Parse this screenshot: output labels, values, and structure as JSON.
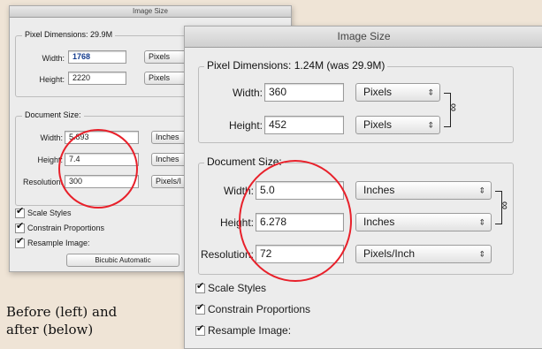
{
  "before": {
    "title": "Image Size",
    "pixel_dimensions": {
      "label": "Pixel Dimensions:",
      "value": "29.9M"
    },
    "width": {
      "label": "Width:",
      "value": "1768",
      "unit": "Pixels"
    },
    "height": {
      "label": "Height:",
      "value": "2220",
      "unit": "Pixels"
    },
    "document_size": {
      "label": "Document Size:"
    },
    "doc_width": {
      "label": "Width:",
      "value": "5.893",
      "unit": "Inches"
    },
    "doc_height": {
      "label": "Height:",
      "value": "7.4",
      "unit": "Inches"
    },
    "resolution": {
      "label": "Resolution:",
      "value": "300",
      "unit": "Pixels/I"
    },
    "scale_styles": "Scale Styles",
    "constrain_proportions": "Constrain Proportions",
    "resample_image": "Resample Image:",
    "resample_method": "Bicubic Automatic"
  },
  "after": {
    "title": "Image Size",
    "pixel_dimensions": {
      "label": "Pixel Dimensions:",
      "value": "1.24M (was 29.9M)"
    },
    "width": {
      "label": "Width:",
      "value": "360",
      "unit": "Pixels"
    },
    "height": {
      "label": "Height:",
      "value": "452",
      "unit": "Pixels"
    },
    "document_size": {
      "label": "Document Size:"
    },
    "doc_width": {
      "label": "Width:",
      "value": "5.0",
      "unit": "Inches"
    },
    "doc_height": {
      "label": "Height:",
      "value": "6.278",
      "unit": "Inches"
    },
    "resolution": {
      "label": "Resolution:",
      "value": "72",
      "unit": "Pixels/Inch"
    },
    "scale_styles": "Scale Styles",
    "constrain_proportions": "Constrain Proportions",
    "resample_image": "Resample Image:"
  },
  "caption": {
    "line1": "Before (left) and",
    "line2": "after (below)"
  },
  "icons": {
    "checkbox_checked": "checkmark-icon",
    "popup": "updown-arrows-icon",
    "link": "chain-link-icon"
  },
  "colors": {
    "highlight_ring": "#e8202a",
    "background": "#efe4d6"
  }
}
